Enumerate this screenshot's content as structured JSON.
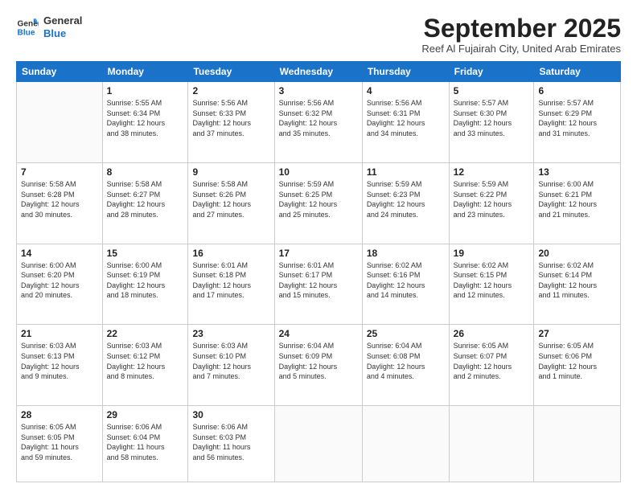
{
  "logo": {
    "line1": "General",
    "line2": "Blue"
  },
  "title": "September 2025",
  "subtitle": "Reef Al Fujairah City, United Arab Emirates",
  "headers": [
    "Sunday",
    "Monday",
    "Tuesday",
    "Wednesday",
    "Thursday",
    "Friday",
    "Saturday"
  ],
  "weeks": [
    [
      {
        "day": "",
        "info": ""
      },
      {
        "day": "1",
        "info": "Sunrise: 5:55 AM\nSunset: 6:34 PM\nDaylight: 12 hours\nand 38 minutes."
      },
      {
        "day": "2",
        "info": "Sunrise: 5:56 AM\nSunset: 6:33 PM\nDaylight: 12 hours\nand 37 minutes."
      },
      {
        "day": "3",
        "info": "Sunrise: 5:56 AM\nSunset: 6:32 PM\nDaylight: 12 hours\nand 35 minutes."
      },
      {
        "day": "4",
        "info": "Sunrise: 5:56 AM\nSunset: 6:31 PM\nDaylight: 12 hours\nand 34 minutes."
      },
      {
        "day": "5",
        "info": "Sunrise: 5:57 AM\nSunset: 6:30 PM\nDaylight: 12 hours\nand 33 minutes."
      },
      {
        "day": "6",
        "info": "Sunrise: 5:57 AM\nSunset: 6:29 PM\nDaylight: 12 hours\nand 31 minutes."
      }
    ],
    [
      {
        "day": "7",
        "info": "Sunrise: 5:58 AM\nSunset: 6:28 PM\nDaylight: 12 hours\nand 30 minutes."
      },
      {
        "day": "8",
        "info": "Sunrise: 5:58 AM\nSunset: 6:27 PM\nDaylight: 12 hours\nand 28 minutes."
      },
      {
        "day": "9",
        "info": "Sunrise: 5:58 AM\nSunset: 6:26 PM\nDaylight: 12 hours\nand 27 minutes."
      },
      {
        "day": "10",
        "info": "Sunrise: 5:59 AM\nSunset: 6:25 PM\nDaylight: 12 hours\nand 25 minutes."
      },
      {
        "day": "11",
        "info": "Sunrise: 5:59 AM\nSunset: 6:23 PM\nDaylight: 12 hours\nand 24 minutes."
      },
      {
        "day": "12",
        "info": "Sunrise: 5:59 AM\nSunset: 6:22 PM\nDaylight: 12 hours\nand 23 minutes."
      },
      {
        "day": "13",
        "info": "Sunrise: 6:00 AM\nSunset: 6:21 PM\nDaylight: 12 hours\nand 21 minutes."
      }
    ],
    [
      {
        "day": "14",
        "info": "Sunrise: 6:00 AM\nSunset: 6:20 PM\nDaylight: 12 hours\nand 20 minutes."
      },
      {
        "day": "15",
        "info": "Sunrise: 6:00 AM\nSunset: 6:19 PM\nDaylight: 12 hours\nand 18 minutes."
      },
      {
        "day": "16",
        "info": "Sunrise: 6:01 AM\nSunset: 6:18 PM\nDaylight: 12 hours\nand 17 minutes."
      },
      {
        "day": "17",
        "info": "Sunrise: 6:01 AM\nSunset: 6:17 PM\nDaylight: 12 hours\nand 15 minutes."
      },
      {
        "day": "18",
        "info": "Sunrise: 6:02 AM\nSunset: 6:16 PM\nDaylight: 12 hours\nand 14 minutes."
      },
      {
        "day": "19",
        "info": "Sunrise: 6:02 AM\nSunset: 6:15 PM\nDaylight: 12 hours\nand 12 minutes."
      },
      {
        "day": "20",
        "info": "Sunrise: 6:02 AM\nSunset: 6:14 PM\nDaylight: 12 hours\nand 11 minutes."
      }
    ],
    [
      {
        "day": "21",
        "info": "Sunrise: 6:03 AM\nSunset: 6:13 PM\nDaylight: 12 hours\nand 9 minutes."
      },
      {
        "day": "22",
        "info": "Sunrise: 6:03 AM\nSunset: 6:12 PM\nDaylight: 12 hours\nand 8 minutes."
      },
      {
        "day": "23",
        "info": "Sunrise: 6:03 AM\nSunset: 6:10 PM\nDaylight: 12 hours\nand 7 minutes."
      },
      {
        "day": "24",
        "info": "Sunrise: 6:04 AM\nSunset: 6:09 PM\nDaylight: 12 hours\nand 5 minutes."
      },
      {
        "day": "25",
        "info": "Sunrise: 6:04 AM\nSunset: 6:08 PM\nDaylight: 12 hours\nand 4 minutes."
      },
      {
        "day": "26",
        "info": "Sunrise: 6:05 AM\nSunset: 6:07 PM\nDaylight: 12 hours\nand 2 minutes."
      },
      {
        "day": "27",
        "info": "Sunrise: 6:05 AM\nSunset: 6:06 PM\nDaylight: 12 hours\nand 1 minute."
      }
    ],
    [
      {
        "day": "28",
        "info": "Sunrise: 6:05 AM\nSunset: 6:05 PM\nDaylight: 11 hours\nand 59 minutes."
      },
      {
        "day": "29",
        "info": "Sunrise: 6:06 AM\nSunset: 6:04 PM\nDaylight: 11 hours\nand 58 minutes."
      },
      {
        "day": "30",
        "info": "Sunrise: 6:06 AM\nSunset: 6:03 PM\nDaylight: 11 hours\nand 56 minutes."
      },
      {
        "day": "",
        "info": ""
      },
      {
        "day": "",
        "info": ""
      },
      {
        "day": "",
        "info": ""
      },
      {
        "day": "",
        "info": ""
      }
    ]
  ]
}
